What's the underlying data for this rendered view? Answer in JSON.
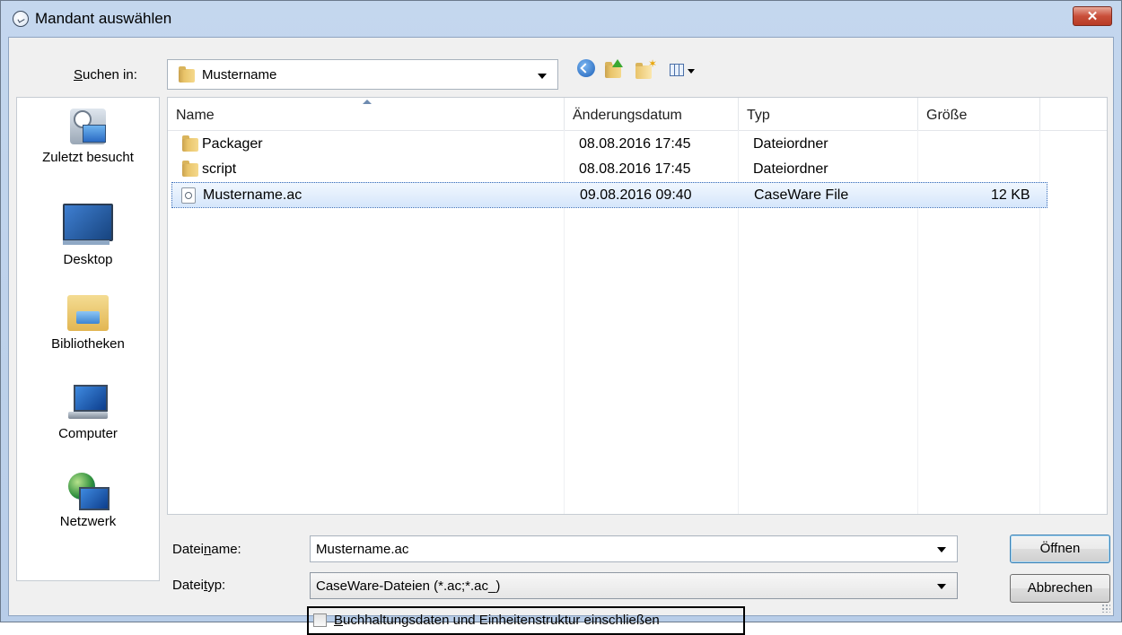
{
  "window": {
    "title": "Mandant auswählen",
    "close_label": "✕"
  },
  "lookin": {
    "label_prefix": "S",
    "label_rest": "uchen in:",
    "value": "Mustername"
  },
  "toolbar": {
    "icons": [
      "back-icon",
      "up-folder-icon",
      "new-folder-icon",
      "view-menu-icon"
    ]
  },
  "places": [
    {
      "label": "Zuletzt besucht",
      "icon": "recent-places-icon"
    },
    {
      "label": "Desktop",
      "icon": "desktop-icon"
    },
    {
      "label": "Bibliotheken",
      "icon": "libraries-icon"
    },
    {
      "label": "Computer",
      "icon": "computer-icon"
    },
    {
      "label": "Netzwerk",
      "icon": "network-icon"
    }
  ],
  "filelist": {
    "columns": [
      "Name",
      "Änderungsdatum",
      "Typ",
      "Größe"
    ],
    "rows": [
      {
        "name": "Packager",
        "date": "08.08.2016 17:45",
        "type": "Dateiordner",
        "size": "",
        "icon": "folder-icon"
      },
      {
        "name": "script",
        "date": "08.08.2016 17:45",
        "type": "Dateiordner",
        "size": "",
        "icon": "folder-icon"
      },
      {
        "name": "Mustername.ac",
        "date": "09.08.2016 09:40",
        "type": "CaseWare File",
        "size": "12 KB",
        "icon": "caseware-file-icon",
        "selected": true
      }
    ]
  },
  "filename": {
    "label_pre": "Datei",
    "label_u": "n",
    "label_post": "ame:",
    "value": "Mustername.ac"
  },
  "filetype": {
    "label_pre": "Datei",
    "label_u": "t",
    "label_post": "yp:",
    "value": "CaseWare-Dateien (*.ac;*.ac_)"
  },
  "buttons": {
    "open": "Öffnen",
    "cancel": "Abbrechen"
  },
  "checkbox": {
    "label_u": "B",
    "label_rest": "uchhaltungsdaten und Einheitenstruktur einschließen",
    "checked": false
  }
}
